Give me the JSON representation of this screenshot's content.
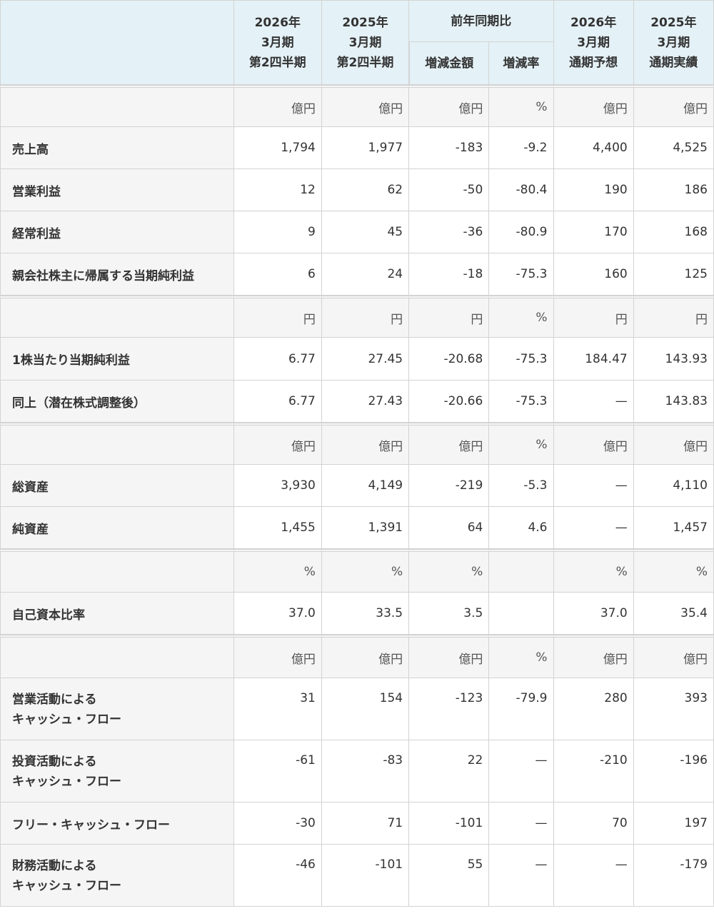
{
  "header": {
    "col1": [
      "2026年",
      "3月期",
      "第2四半期"
    ],
    "col2": [
      "2025年",
      "3月期",
      "第2四半期"
    ],
    "yoy": "前年同期比",
    "yoy_amount": "増減金額",
    "yoy_rate": "増減率",
    "col5": [
      "2026年",
      "3月期",
      "通期予想"
    ],
    "col6": [
      "2025年",
      "3月期",
      "通期実績"
    ]
  },
  "groups": [
    {
      "units": [
        "億円",
        "億円",
        "億円",
        "%",
        "億円",
        "億円"
      ],
      "rows": [
        {
          "label": [
            "売上高"
          ],
          "values": [
            "1,794",
            "1,977",
            "-183",
            "-9.2",
            "4,400",
            "4,525"
          ]
        },
        {
          "label": [
            "営業利益"
          ],
          "values": [
            "12",
            "62",
            "-50",
            "-80.4",
            "190",
            "186"
          ]
        },
        {
          "label": [
            "経常利益"
          ],
          "values": [
            "9",
            "45",
            "-36",
            "-80.9",
            "170",
            "168"
          ]
        },
        {
          "label": [
            "親会社株主に帰属する当期純利益"
          ],
          "values": [
            "6",
            "24",
            "-18",
            "-75.3",
            "160",
            "125"
          ]
        }
      ]
    },
    {
      "units": [
        "円",
        "円",
        "円",
        "%",
        "円",
        "円"
      ],
      "rows": [
        {
          "label": [
            "1株当たり当期純利益"
          ],
          "values": [
            "6.77",
            "27.45",
            "-20.68",
            "-75.3",
            "184.47",
            "143.93"
          ]
        },
        {
          "label": [
            "同上（潜在株式調整後）"
          ],
          "values": [
            "6.77",
            "27.43",
            "-20.66",
            "-75.3",
            "—",
            "143.83"
          ]
        }
      ]
    },
    {
      "units": [
        "億円",
        "億円",
        "億円",
        "%",
        "億円",
        "億円"
      ],
      "rows": [
        {
          "label": [
            "総資産"
          ],
          "values": [
            "3,930",
            "4,149",
            "-219",
            "-5.3",
            "—",
            "4,110"
          ]
        },
        {
          "label": [
            "純資産"
          ],
          "values": [
            "1,455",
            "1,391",
            "64",
            "4.6",
            "—",
            "1,457"
          ]
        }
      ]
    },
    {
      "units": [
        "%",
        "%",
        "%",
        "",
        "%",
        "%"
      ],
      "rows": [
        {
          "label": [
            "自己資本比率"
          ],
          "values": [
            "37.0",
            "33.5",
            "3.5",
            "",
            "37.0",
            "35.4"
          ]
        }
      ]
    },
    {
      "units": [
        "億円",
        "億円",
        "億円",
        "%",
        "億円",
        "億円"
      ],
      "rows": [
        {
          "label": [
            "営業活動による",
            "キャッシュ・フロー"
          ],
          "values": [
            "31",
            "154",
            "-123",
            "-79.9",
            "280",
            "393"
          ]
        },
        {
          "label": [
            "投資活動による",
            "キャッシュ・フロー"
          ],
          "values": [
            "-61",
            "-83",
            "22",
            "—",
            "-210",
            "-196"
          ]
        },
        {
          "label": [
            "フリー・キャッシュ・フロー"
          ],
          "values": [
            "-30",
            "71",
            "-101",
            "—",
            "70",
            "197"
          ]
        },
        {
          "label": [
            "財務活動による",
            "キャッシュ・フロー"
          ],
          "values": [
            "-46",
            "-101",
            "55",
            "—",
            "—",
            "-179"
          ]
        }
      ]
    }
  ]
}
